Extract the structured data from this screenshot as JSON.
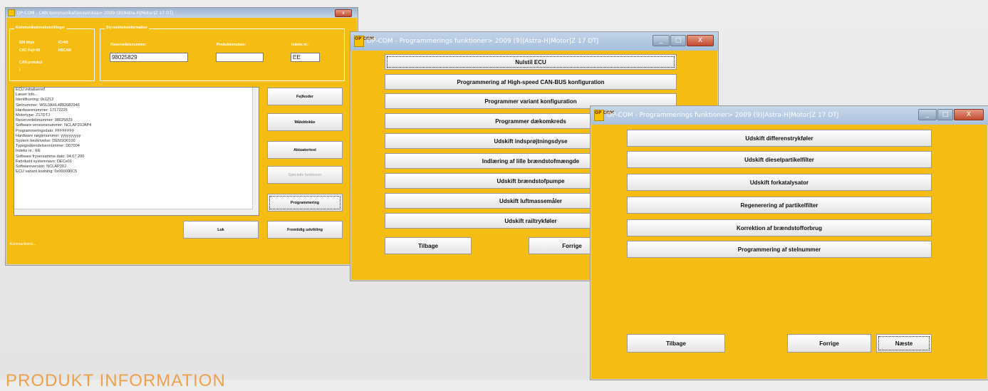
{
  "caption": "PRODUKT INFORMATION",
  "w1": {
    "title": "OP-COM - CAN kommunikationsvindue> 2009 (9)|Astra-H|Motor|Z 17 DTJ",
    "group_comm_title": "Kommunikationsindstillinger",
    "comm_baud": "500 kbps",
    "comm_ic": "IC=00",
    "comm_crc": "CRC Fejl=00",
    "comm_hscan": "HSCAN",
    "comm_protocol_label": "CAN protokol",
    "comm_protocol_value": "/",
    "group_ecu_title": "Styreenhedsinformation",
    "reserve_label": "Reservedelsnummer:",
    "reserve_value": "98025829",
    "proddate_label": "Produktionsdato:",
    "proddate_value": "",
    "index_label": "Indeks nr.:",
    "index_value": "EE",
    "log": [
      "ECU initialiseret!",
      "",
      "Læser info...",
      "",
      "Identificering: 0x1212",
      "Stelnummer: W0L0AHL4882082946",
      "Hardwarenummer: 17172225",
      "Motortype: Z17DTJ",
      "Reservedelsnummer: 98025829",
      "Software versionsnummer: NCLAP20JAP4",
      "Programmeringsdato: FFFFFFFF",
      "Hardware nøglenummer: yyyyyyyyyy",
      "System beskrivelse: DENSO0100",
      "Typegodkendelsesnummer: D07004",
      "Indeks nr.: EE",
      "Software frysersamme dato: 04.07.200",
      "Fabrikant systemnavn: DECe01",
      "Softwareversion: NCLAP20J",
      "ECU variant kodning: 0x000000C5"
    ],
    "btn_fejlkoder": "Fejlkoder",
    "btn_maaleblokke": "Måleblokke",
    "btn_aktuatortest": "Aktuatortest",
    "btn_specielle": "Specielle funktioner",
    "btn_programmering": "Programmering",
    "btn_luk": "Luk",
    "btn_fremtidig": "Fremtidig udvikling",
    "status": "Kommunikerer...",
    "btn_min": "_",
    "btn_max": "□",
    "btn_close": "x"
  },
  "w2": {
    "title": "OP-COM - Programmerings funktioner> 2009 (9)|Astra-H|Motor|Z 17 DTJ",
    "items": [
      "Nulstil ECU",
      "Programmering af High-speed CAN-BUS konfiguration",
      "Programmer variant konfiguration",
      "Programmer dækomkreds",
      "Udskift indsprøjtningsdyse",
      "Indlæring af lille brændstofmængde",
      "Udskift brændstofpumpe",
      "Udskift luftmassemåler",
      "Udskift railtrykføler"
    ],
    "btn_tilbage": "Tilbage",
    "btn_forrige": "Forrige",
    "btn_min": "_",
    "btn_max": "□",
    "btn_close": "X"
  },
  "w3": {
    "title": "OP-COM - Programmerings funktioner> 2009 (9)|Astra-H|Motor|Z 17 DTJ",
    "items": [
      "Udskift differenstrykføler",
      "Udskift dieselpartikelfilter",
      "Udskift forkatalysator",
      "Regenerering af partikelfilter",
      "Korrektion af brændstofforbrug",
      "Programmering af stelnummer"
    ],
    "btn_tilbage": "Tilbage",
    "btn_forrige": "Forrige",
    "btn_naeste": "Næste",
    "btn_min": "_",
    "btn_max": "□",
    "btn_close": "X"
  },
  "icon_text": "OP COM"
}
